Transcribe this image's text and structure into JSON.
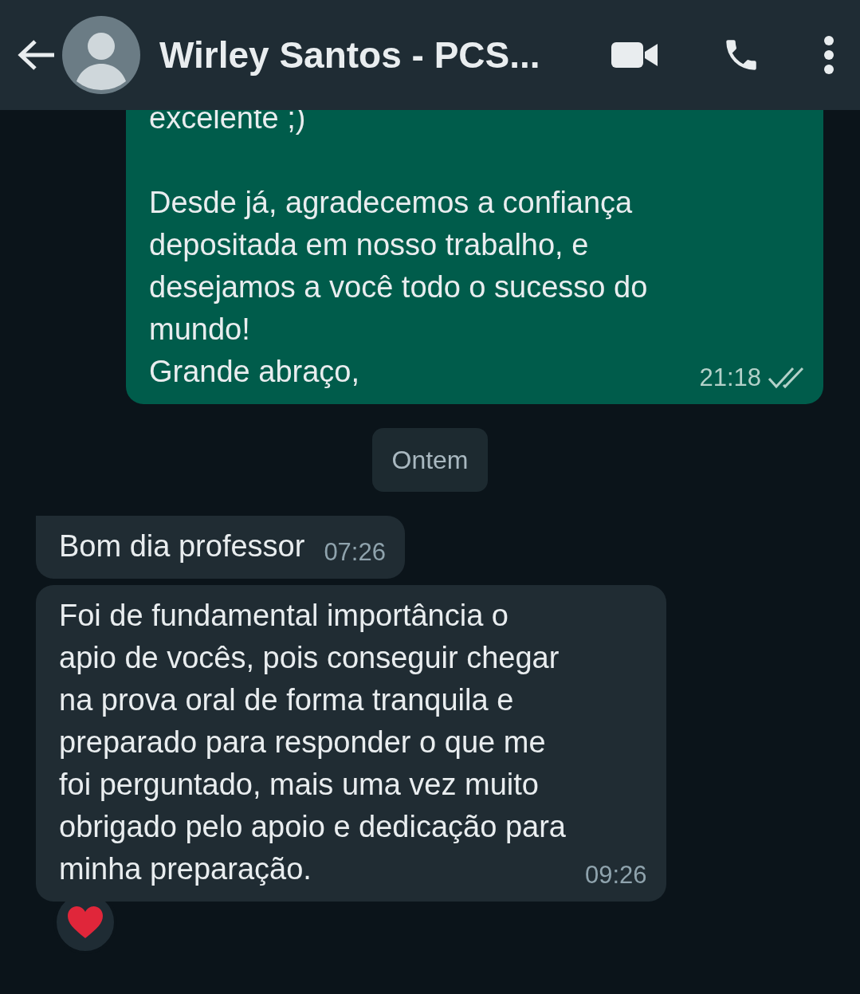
{
  "header": {
    "title": "Wirley Santos - PCS..."
  },
  "messages": [
    {
      "kind": "outgoing",
      "text": "excelente ;)\n\nDesde já, agradecemos a confiança\ndepositada em nosso trabalho, e\ndesejamos a você todo o sucesso do\nmundo!\nGrande abraço,",
      "time": "21:18",
      "read": false
    },
    {
      "kind": "date",
      "text": "Ontem"
    },
    {
      "kind": "incoming",
      "text": "Bom dia professor",
      "time": "07:26"
    },
    {
      "kind": "incoming",
      "text": "Foi de fundamental importância o\napio de vocês, pois conseguir chegar\nna prova oral de forma tranquila e\npreparado para responder o que me\nfoi perguntado, mais uma vez muito\nobrigado pelo apoio e dedicação para\nminha preparação.",
      "time": "09:26",
      "reacted": true
    }
  ]
}
